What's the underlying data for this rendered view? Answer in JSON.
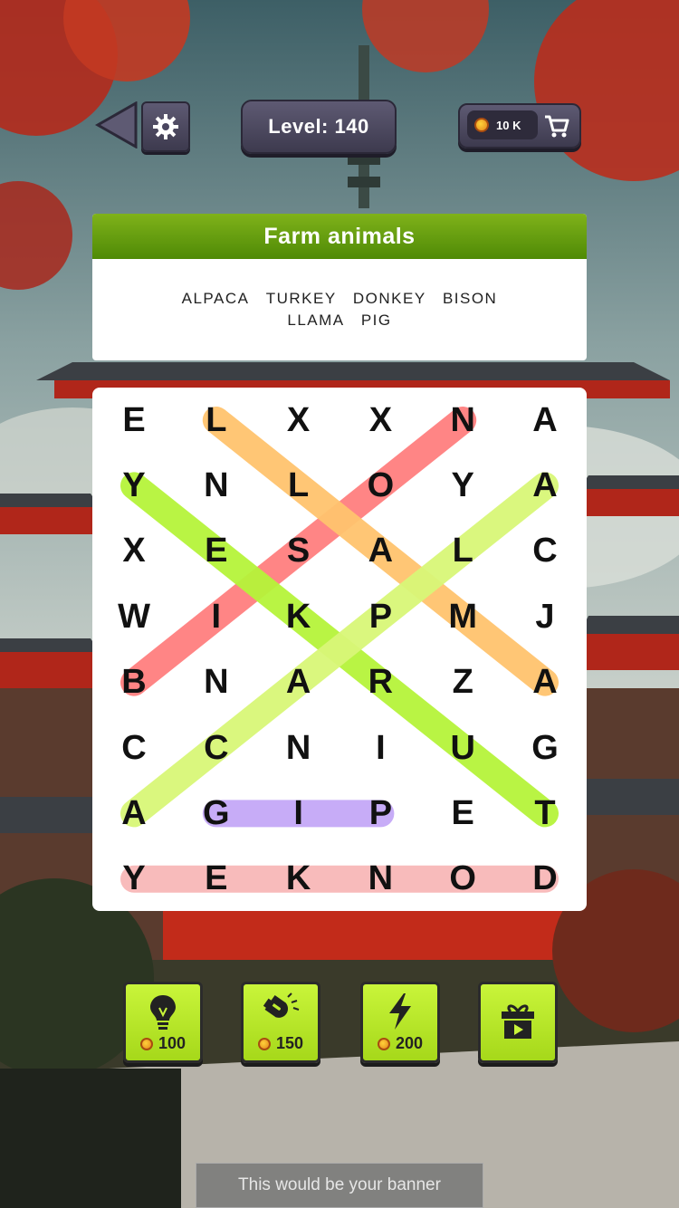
{
  "header": {
    "level_label": "Level: 140",
    "coins": "10 K"
  },
  "category": {
    "title": "Farm animals",
    "words": [
      "ALPACA",
      "TURKEY",
      "DONKEY",
      "BISON",
      "LLAMA",
      "PIG"
    ]
  },
  "grid": {
    "rows": [
      [
        "E",
        "L",
        "X",
        "X",
        "N",
        "A"
      ],
      [
        "Y",
        "N",
        "L",
        "O",
        "Y",
        "A"
      ],
      [
        "X",
        "E",
        "S",
        "A",
        "L",
        "C"
      ],
      [
        "W",
        "I",
        "K",
        "P",
        "M",
        "J"
      ],
      [
        "B",
        "N",
        "A",
        "R",
        "Z",
        "A"
      ],
      [
        "C",
        "C",
        "N",
        "I",
        "U",
        "G"
      ],
      [
        "A",
        "G",
        "I",
        "P",
        "E",
        "T"
      ],
      [
        "Y",
        "E",
        "K",
        "N",
        "O",
        "D"
      ]
    ],
    "found_words": [
      {
        "word": "BISON",
        "from": [
          4,
          0
        ],
        "to": [
          0,
          4
        ],
        "color": "#ff7f7f"
      },
      {
        "word": "LLAMA",
        "from": [
          0,
          1
        ],
        "to": [
          4,
          5
        ],
        "color": "#ffc46e"
      },
      {
        "word": "TURKEY",
        "from": [
          6,
          5
        ],
        "to": [
          1,
          0
        ],
        "color": "#b6f43a"
      },
      {
        "word": "ALPACA",
        "from": [
          6,
          0
        ],
        "to": [
          1,
          5
        ],
        "color": "#d9f778"
      },
      {
        "word": "PIG",
        "from": [
          6,
          3
        ],
        "to": [
          6,
          1
        ],
        "color": "#c5a8f7"
      },
      {
        "word": "DONKEY",
        "from": [
          7,
          5
        ],
        "to": [
          7,
          0
        ],
        "color": "#f8b8b8"
      }
    ]
  },
  "powerups": [
    {
      "icon": "lightbulb-icon",
      "cost": "100"
    },
    {
      "icon": "magnet-icon",
      "cost": "150"
    },
    {
      "icon": "lightning-icon",
      "cost": "200"
    },
    {
      "icon": "gift-video-icon",
      "cost": ""
    }
  ],
  "banner": {
    "text": "This would be your banner"
  },
  "colors": {
    "accent_green": "#b7ea2a",
    "header_green": "#5f9a0c",
    "panel_dark": "#4a4660"
  }
}
